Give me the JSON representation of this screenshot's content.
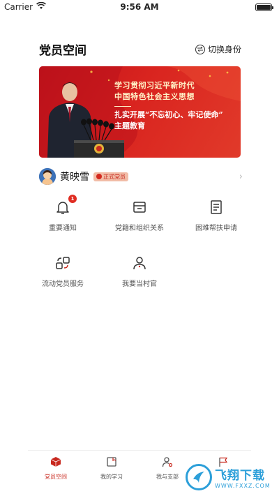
{
  "status_bar": {
    "carrier": "Carrier",
    "time": "9:56 AM",
    "battery_level": 1.0
  },
  "header": {
    "title": "党员空间",
    "switch_label": "切换身份"
  },
  "banner": {
    "line1": "学习贯彻习近平新时代",
    "line2": "中国特色社会主义思想",
    "line3": "扎实开展“不忘初心、牢记使命”",
    "line4": "主题教育"
  },
  "user": {
    "name": "黄映雪",
    "badge": "正式党员"
  },
  "grid": [
    {
      "label": "重要通知",
      "icon": "bell-icon",
      "badge": "1"
    },
    {
      "label": "党籍和组织关系",
      "icon": "inbox-tray-icon"
    },
    {
      "label": "困难帮扶申请",
      "icon": "document-icon"
    },
    {
      "label": "流动党员服务",
      "icon": "transfer-icon"
    },
    {
      "label": "我要当村官",
      "icon": "person-icon"
    }
  ],
  "tabs": [
    {
      "label": "党员空间",
      "icon": "cube-icon",
      "active": true
    },
    {
      "label": "我的学习",
      "icon": "study-icon",
      "active": false
    },
    {
      "label": "我与支部",
      "icon": "person-gear-icon",
      "active": false
    },
    {
      "label": "",
      "icon": "flag-icon",
      "active": false
    }
  ],
  "watermark": {
    "title": "飞翔下载",
    "url": "WWW.FXXZ.COM"
  },
  "colors": {
    "accent": "#c8281e",
    "banner_red": "#d9241f",
    "badge_red": "#e02d22",
    "watermark_blue": "#2c9fd9"
  }
}
